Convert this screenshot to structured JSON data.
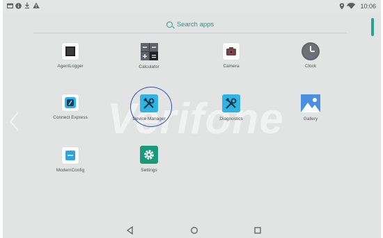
{
  "status_bar": {
    "left_icons": [
      "screenshot-icon",
      "info-icon",
      "download-icon",
      "warning-icon"
    ],
    "right_icons": [
      "location-icon",
      "wifi-icon"
    ],
    "time": "10:06"
  },
  "search": {
    "label": "Search apps"
  },
  "watermark": "Verifone",
  "apps": [
    {
      "id": "agentlogger",
      "label": "AgentLogger",
      "icon": "agentlogger-icon",
      "color": "#ffffff"
    },
    {
      "id": "calculator",
      "label": "Calculator",
      "icon": "calculator-icon",
      "color": "#3c4043"
    },
    {
      "id": "camera",
      "label": "Camera",
      "icon": "camera-icon",
      "color": "#ffffff"
    },
    {
      "id": "clock",
      "label": "Clock",
      "icon": "clock-icon",
      "color": "#5f6368"
    },
    {
      "id": "connect-express",
      "label": "Connect Express",
      "icon": "connect-express-icon",
      "color": "#ffffff"
    },
    {
      "id": "device-manager",
      "label": "Device Manager",
      "icon": "tools-icon",
      "color": "#2fb4e4"
    },
    {
      "id": "diagnostics",
      "label": "Diagnostics",
      "icon": "tools-icon",
      "color": "#2fb4e4"
    },
    {
      "id": "gallery",
      "label": "Gallery",
      "icon": "gallery-icon",
      "color": "#4a90e2"
    },
    {
      "id": "modemconfig",
      "label": "ModemConfig",
      "icon": "modemconfig-icon",
      "color": "#ffffff"
    },
    {
      "id": "settings",
      "label": "Settings",
      "icon": "settings-icon",
      "color": "#1a9a7a"
    }
  ],
  "nav": [
    "back-icon",
    "home-icon",
    "recents-icon"
  ]
}
